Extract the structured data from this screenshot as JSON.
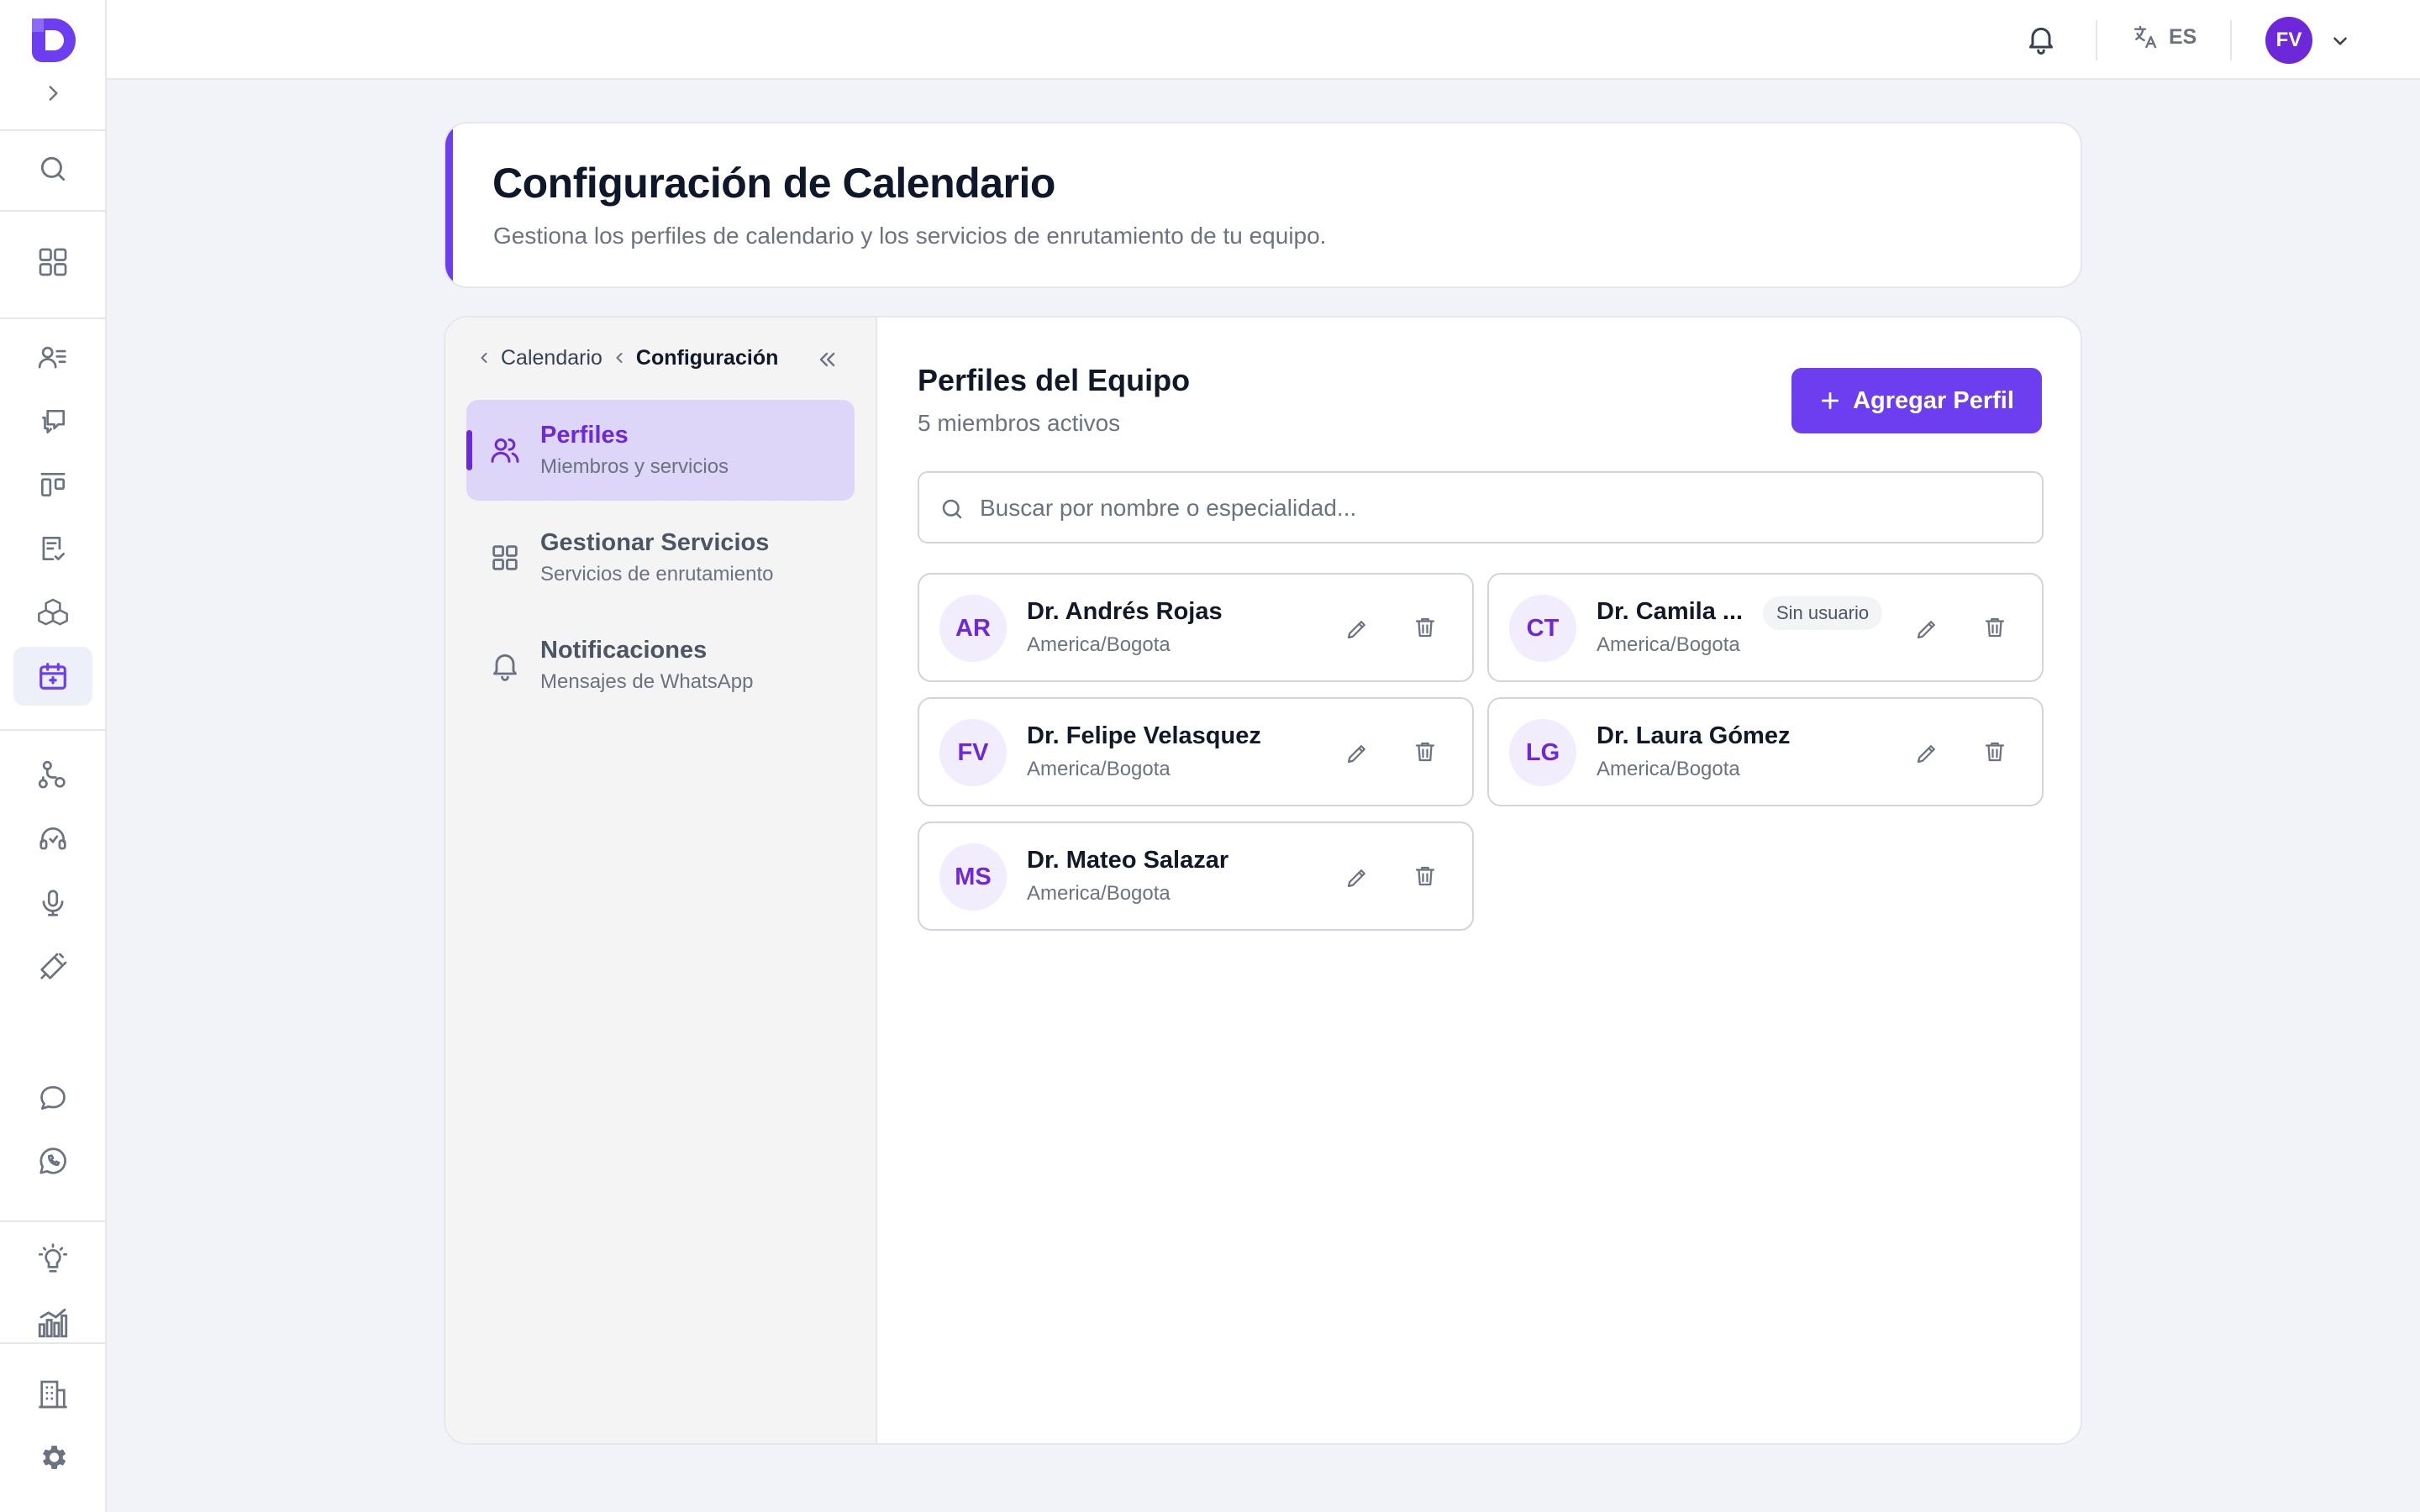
{
  "topbar": {
    "language": "ES",
    "avatar_initials": "FV"
  },
  "header": {
    "title": "Configuración de Calendario",
    "subtitle": "Gestiona los perfiles de calendario y los servicios de enrutamiento de tu equipo."
  },
  "breadcrumb": {
    "parent": "Calendario",
    "current": "Configuración"
  },
  "subnav": [
    {
      "title": "Perfiles",
      "subtitle": "Miembros y servicios",
      "active": true,
      "icon": "users-icon"
    },
    {
      "title": "Gestionar Servicios",
      "subtitle": "Servicios de enrutamiento",
      "active": false,
      "icon": "grid-icon"
    },
    {
      "title": "Notificaciones",
      "subtitle": "Mensajes de WhatsApp",
      "active": false,
      "icon": "bell-icon"
    }
  ],
  "main": {
    "title": "Perfiles del Equipo",
    "count": "5 miembros activos",
    "add_button": "Agregar Perfil",
    "search_placeholder": "Buscar por nombre o especialidad..."
  },
  "profiles": [
    {
      "initials": "AR",
      "name": "Dr. Andrés Rojas",
      "timezone": "America/Bogota",
      "badge": ""
    },
    {
      "initials": "CT",
      "name": "Dr. Camila ...",
      "timezone": "America/Bogota",
      "badge": "Sin usuario"
    },
    {
      "initials": "FV",
      "name": "Dr. Felipe Velasquez",
      "timezone": "America/Bogota",
      "badge": ""
    },
    {
      "initials": "LG",
      "name": "Dr. Laura Gómez",
      "timezone": "America/Bogota",
      "badge": ""
    },
    {
      "initials": "MS",
      "name": "Dr. Mateo Salazar",
      "timezone": "America/Bogota",
      "badge": ""
    }
  ],
  "colors": {
    "accent": "#6d3df0",
    "accent_dark": "#6d28d9",
    "active_nav_bg": "#ddd6f8",
    "avatar_bg": "#f1edfc",
    "page_bg": "#f1f3f8"
  }
}
